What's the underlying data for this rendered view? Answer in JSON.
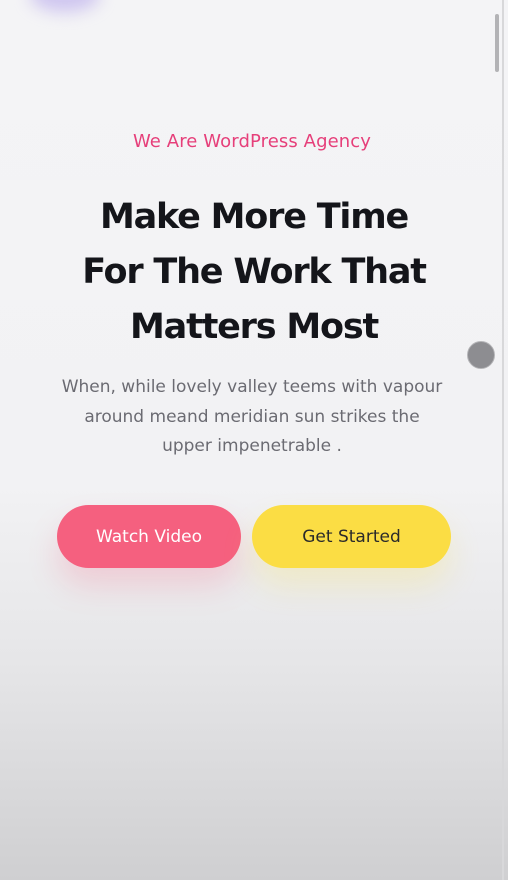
{
  "hero": {
    "tagline": "We Are WordPress Agency",
    "headline_lines": [
      "Make More Time",
      "For The Work That",
      "Matters Most"
    ],
    "description_lines": [
      "When, while lovely valley teems with vapour",
      "around meand meridian sun strikes the",
      "upper impenetrable ."
    ],
    "watch_video_label": "Watch Video",
    "get_started_label": "Get Started"
  },
  "colors": {
    "accent_pink": "#e63f7a",
    "watch_button": "#f5607f",
    "start_button": "#fbdd44",
    "headline": "#14151a",
    "body_text": "#6b6b72"
  }
}
